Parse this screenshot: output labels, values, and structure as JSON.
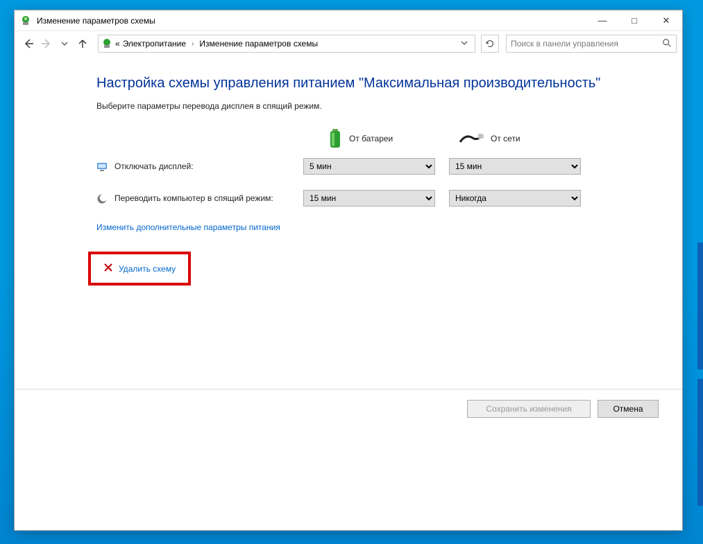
{
  "window_title": "Изменение параметров схемы",
  "breadcrumb": {
    "prefix": "«",
    "items": [
      "Электропитание",
      "Изменение параметров схемы"
    ]
  },
  "search_placeholder": "Поиск в панели управления",
  "page": {
    "heading": "Настройка схемы управления питанием \"Максимальная производительность\"",
    "subheading": "Выберите параметры перевода дисплея в спящий режим.",
    "col_battery": "От батареи",
    "col_plugged": "От сети",
    "rows": [
      {
        "label": "Отключать дисплей:",
        "battery_value": "5 мин",
        "plugged_value": "15 мин"
      },
      {
        "label": "Переводить компьютер в спящий режим:",
        "battery_value": "15 мин",
        "plugged_value": "Никогда"
      }
    ],
    "link_advanced": "Изменить дополнительные параметры питания",
    "link_delete": "Удалить схему"
  },
  "buttons": {
    "save": "Сохранить изменения",
    "cancel": "Отмена"
  },
  "win_controls": {
    "min": "—",
    "max": "□",
    "close": "✕"
  }
}
